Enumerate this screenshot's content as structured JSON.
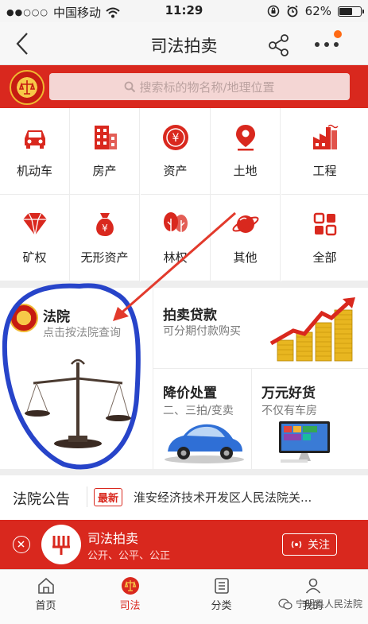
{
  "status_bar": {
    "signal": "●●○○○",
    "carrier": "中国移动",
    "time": "11:29",
    "battery_percent": "62%",
    "battery_level": 0.62
  },
  "nav": {
    "title": "司法拍卖"
  },
  "search": {
    "placeholder": "搜索标的物名称/地理位置"
  },
  "categories": [
    {
      "label": "机动车",
      "icon": "car-icon"
    },
    {
      "label": "房产",
      "icon": "building-icon"
    },
    {
      "label": "资产",
      "icon": "yen-coin-icon"
    },
    {
      "label": "土地",
      "icon": "location-pin-icon"
    },
    {
      "label": "工程",
      "icon": "factory-icon"
    },
    {
      "label": "矿权",
      "icon": "diamond-icon"
    },
    {
      "label": "无形资产",
      "icon": "money-bag-icon"
    },
    {
      "label": "林权",
      "icon": "tree-icon"
    },
    {
      "label": "其他",
      "icon": "planet-icon"
    },
    {
      "label": "全部",
      "icon": "grid-icon"
    }
  ],
  "promo": {
    "court": {
      "title": "法院",
      "subtitle": "点击按法院查询"
    },
    "loan": {
      "title": "拍卖贷款",
      "subtitle": "可分期付款购买"
    },
    "price_cut": {
      "title": "降价处置",
      "subtitle": "二、三拍/变卖"
    },
    "goods": {
      "title": "万元好货",
      "subtitle": "不仅有车房"
    }
  },
  "notice": {
    "title": "法院公告",
    "badge": "最新",
    "text": "淮安经济技术开发区人民法院关..."
  },
  "follow_bar": {
    "name": "司法拍卖",
    "slogan": "公开、公平、公正",
    "button": "关注"
  },
  "tabs": [
    {
      "label": "首页",
      "icon": "home-icon",
      "active": false
    },
    {
      "label": "司法",
      "icon": "court-emblem-icon",
      "active": true
    },
    {
      "label": "分类",
      "icon": "list-icon",
      "active": false
    },
    {
      "label": "我的",
      "icon": "user-icon",
      "active": false
    }
  ],
  "watermark": "宁明县人民法院",
  "colors": {
    "brand_red": "#d9281e",
    "annotation_blue": "#2744c9",
    "annotation_red": "#e23a2c",
    "notify_dot": "#ff6a14"
  }
}
